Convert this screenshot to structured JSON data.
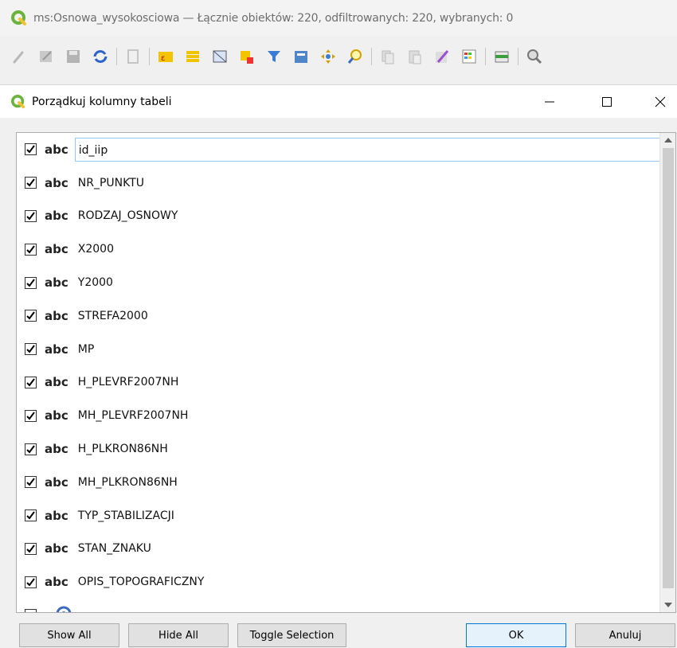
{
  "window": {
    "title": "ms:Osnowa_wysokosciowa — Łącznie obiektów: 220, odfiltrowanych: 220, wybranych: 0"
  },
  "toolbar": {
    "icons": [
      "edit-pencil-icon",
      "toggle-edit-icon",
      "save-icon",
      "refresh-icon",
      "delete-icon",
      "select-expression-icon",
      "select-all-icon",
      "invert-selection-icon",
      "deselect-icon",
      "filter-icon",
      "move-top-icon",
      "pan-to-icon",
      "zoom-to-icon",
      "copy-icon",
      "paste-icon",
      "field-calculator-icon",
      "conditional-format-icon",
      "dock-icon",
      "zoom-map-icon"
    ]
  },
  "dialog": {
    "title": "Porządkuj kolumny tabeli",
    "minimize_glyph": "—",
    "maximize_glyph": "☐",
    "close_glyph": "✕"
  },
  "columns": [
    {
      "type": "abc",
      "name": "id_iip",
      "checked": true
    },
    {
      "type": "abc",
      "name": "NR_PUNKTU",
      "checked": true
    },
    {
      "type": "abc",
      "name": "RODZAJ_OSNOWY",
      "checked": true
    },
    {
      "type": "abc",
      "name": "X2000",
      "checked": true
    },
    {
      "type": "abc",
      "name": "Y2000",
      "checked": true
    },
    {
      "type": "abc",
      "name": "STREFA2000",
      "checked": true
    },
    {
      "type": "abc",
      "name": "MP",
      "checked": true
    },
    {
      "type": "abc",
      "name": "H_PLEVRF2007NH",
      "checked": true
    },
    {
      "type": "abc",
      "name": "MH_PLEVRF2007NH",
      "checked": true
    },
    {
      "type": "abc",
      "name": "H_PLKRON86NH",
      "checked": true
    },
    {
      "type": "abc",
      "name": "MH_PLKRON86NH",
      "checked": true
    },
    {
      "type": "abc",
      "name": "TYP_STABILIZACJI",
      "checked": true
    },
    {
      "type": "abc",
      "name": "STAN_ZNAKU",
      "checked": true
    },
    {
      "type": "abc",
      "name": "OPIS_TOPOGRAFICZNY",
      "checked": true
    }
  ],
  "buttons": {
    "show_all": "Show All",
    "hide_all": "Hide All",
    "toggle_selection": "Toggle Selection",
    "ok": "OK",
    "cancel": "Anuluj"
  },
  "colors": {
    "accent": "#0078d7",
    "qgis_green": "#6cb33e",
    "qgis_yellow": "#f0c22e"
  }
}
